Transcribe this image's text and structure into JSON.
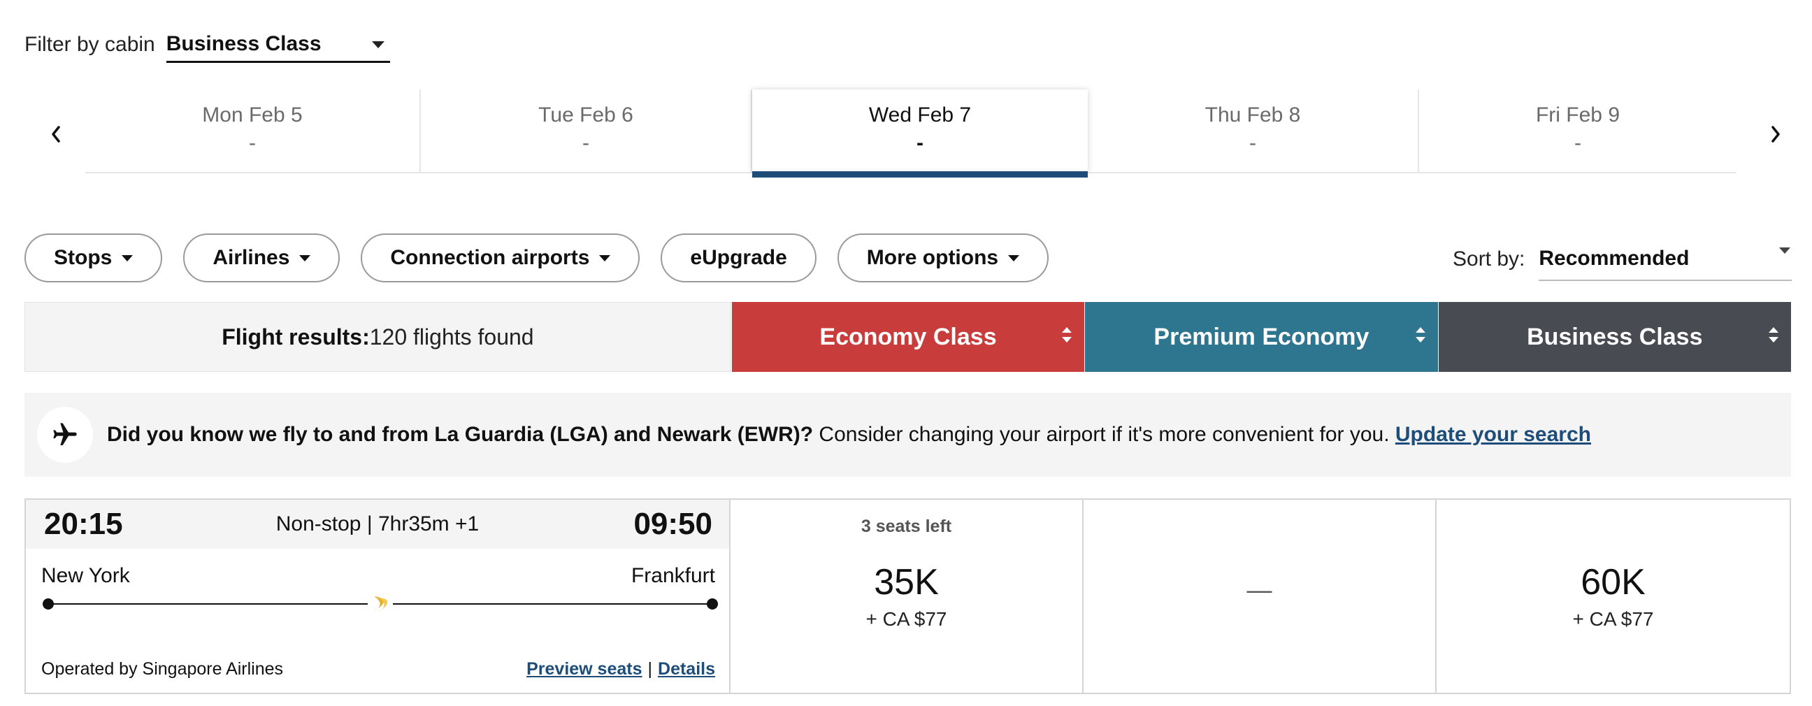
{
  "filter": {
    "label": "Filter by cabin",
    "value": "Business Class"
  },
  "dates": [
    {
      "label": "Mon Feb 5",
      "price": "-",
      "active": false
    },
    {
      "label": "Tue Feb 6",
      "price": "-",
      "active": false
    },
    {
      "label": "Wed Feb 7",
      "price": "-",
      "active": true
    },
    {
      "label": "Thu Feb 8",
      "price": "-",
      "active": false
    },
    {
      "label": "Fri Feb 9",
      "price": "-",
      "active": false
    }
  ],
  "pills": {
    "stops": "Stops",
    "airlines": "Airlines",
    "connection_airports": "Connection airports",
    "eupgrade": "eUpgrade",
    "more_options": "More options"
  },
  "sort": {
    "label": "Sort by:",
    "value": "Recommended"
  },
  "results": {
    "title": "Flight results:",
    "count": "120 flights found",
    "columns": {
      "economy": "Economy Class",
      "premium": "Premium Economy",
      "business": "Business Class"
    },
    "colors": {
      "economy": "#c83c3c",
      "premium": "#2e7590",
      "business": "#484c52"
    }
  },
  "banner": {
    "bold_text": "Did you know we fly to and from La Guardia (LGA) and Newark (EWR)?",
    "text": " Consider changing your airport if it's more convenient for you. ",
    "link": "Update your search",
    "icon": "airplane-icon"
  },
  "flight": {
    "departure_time": "20:15",
    "arrival_time": "09:50",
    "duration": "Non-stop | 7hr35m +1",
    "origin": "New York",
    "destination": "Frankfurt",
    "operated_by": "Operated by Singapore Airlines",
    "preview_seats": "Preview seats",
    "separator": "|",
    "details": "Details",
    "logo_icon": "singapore-airlines-logo",
    "fares": {
      "economy": {
        "seats": "3 seats left",
        "miles": "35K",
        "cash": "+ CA $77"
      },
      "premium": {
        "dash": "—"
      },
      "business": {
        "miles": "60K",
        "cash": "+ CA $77"
      }
    }
  }
}
